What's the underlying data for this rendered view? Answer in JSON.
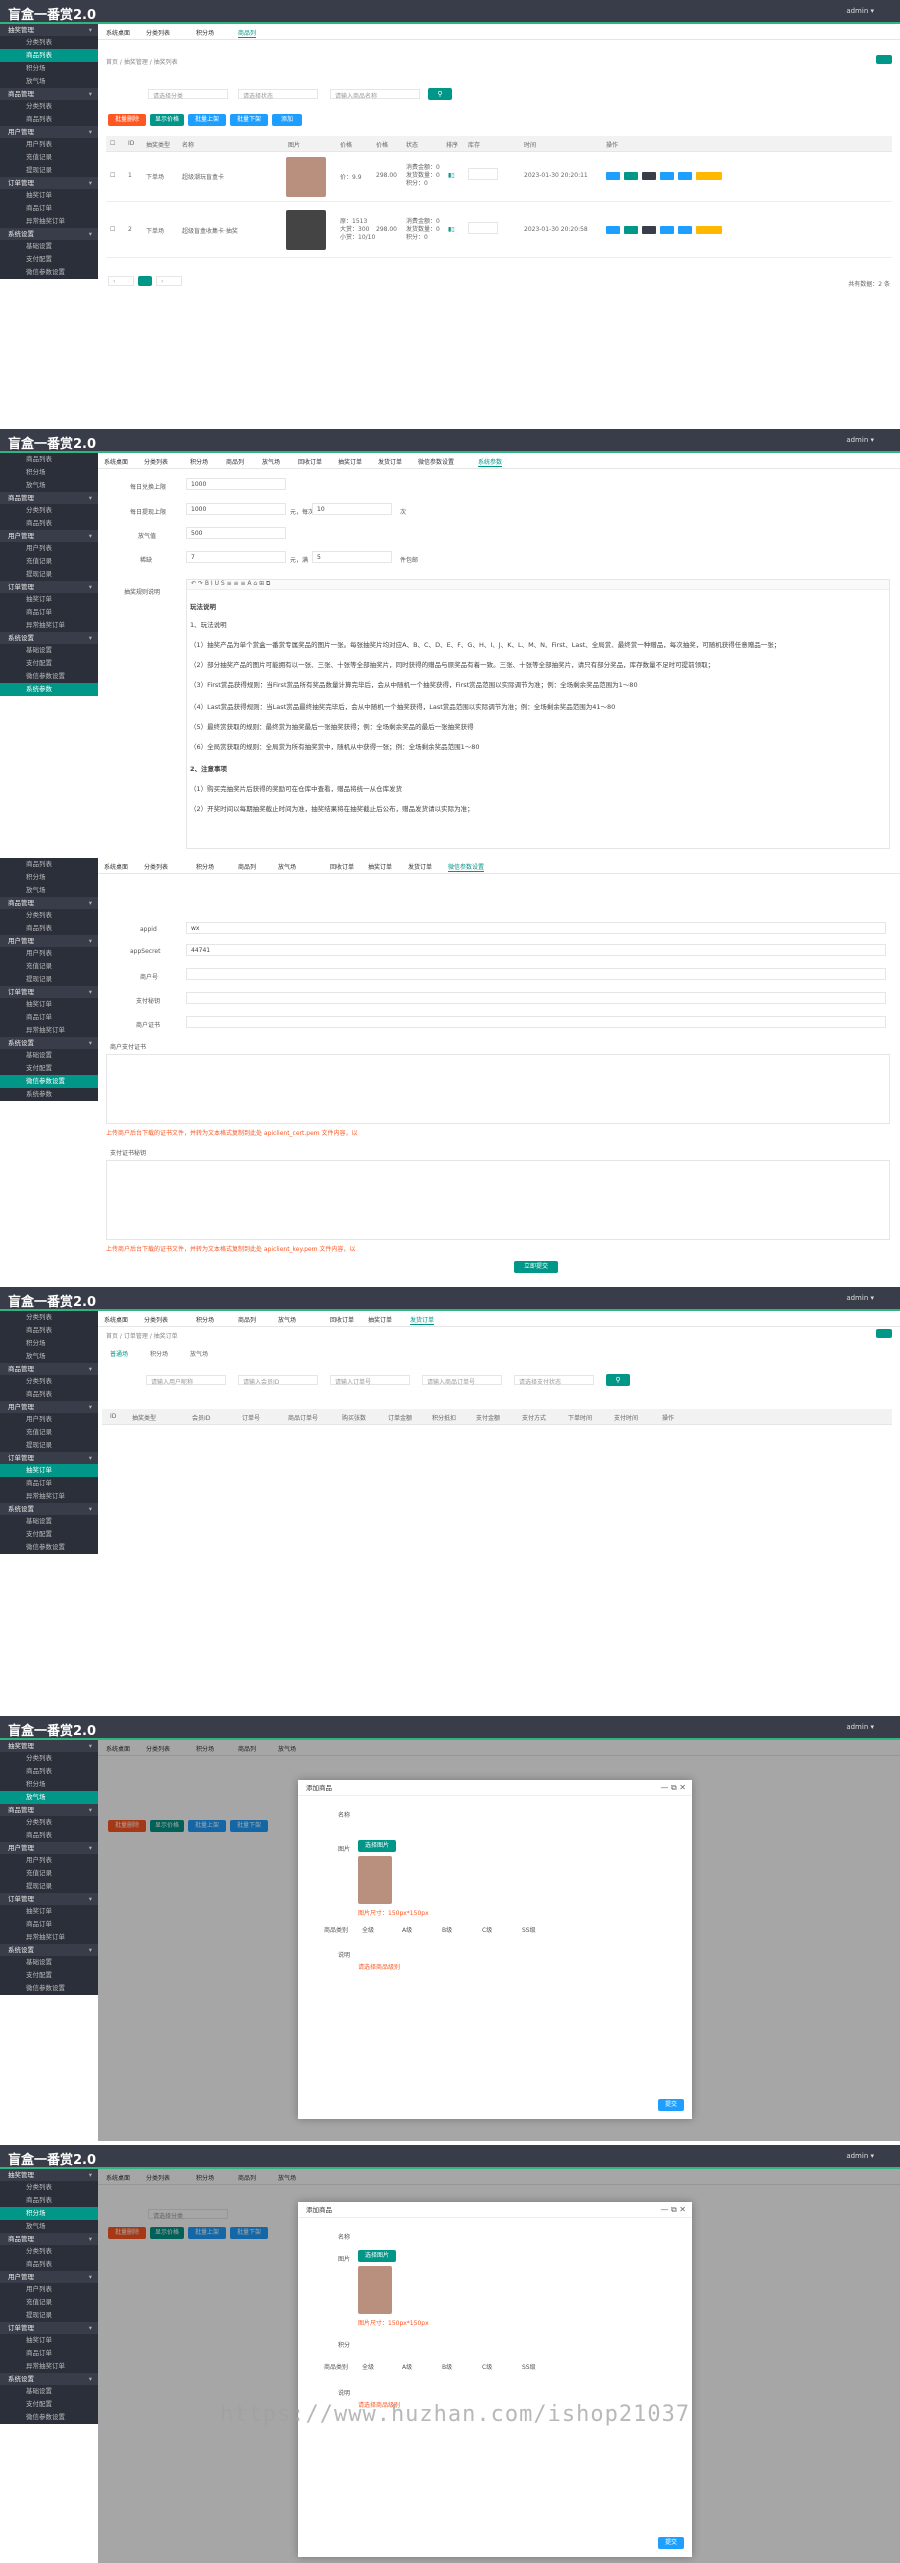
{
  "app_title": "盲盒一番赏2.0",
  "admin_label": "admin ▾",
  "sidebar": [
    {
      "label": "抽奖管理",
      "items": [
        "分类列表",
        "商品列表",
        "积分场",
        "放气场"
      ]
    },
    {
      "label": "商品管理",
      "items": [
        "分类列表",
        "商品列表"
      ]
    },
    {
      "label": "用户管理",
      "items": [
        "用户列表",
        "充值记录",
        "提现记录"
      ]
    },
    {
      "label": "订单管理",
      "items": [
        "抽奖订单",
        "商品订单",
        "异常抽奖订单"
      ]
    },
    {
      "label": "系统设置",
      "items": [
        "基础设置",
        "支付配置",
        "微信参数设置",
        "系统参数"
      ]
    }
  ],
  "panel1": {
    "tabs": [
      "系统桌面",
      "分类列表",
      "积分场",
      "商品列",
      "放气场"
    ],
    "breadcrumb": "首页 / 抽奖管理 / 抽奖列表",
    "filters": [
      "请选择分类",
      "请选择状态",
      "请输入商品名称"
    ],
    "buttons": [
      "批量删除",
      "显示价格",
      "批量上架",
      "批量下架",
      "添加"
    ],
    "columns": [
      "ID",
      "抽奖类型",
      "名称",
      "图片",
      "价格",
      "价格",
      "状态",
      "排序",
      "库存",
      "时间",
      "操作"
    ],
    "rows": [
      {
        "id": "1",
        "type": "下单场",
        "name": "超级潮玩盲盒卡",
        "price": "价：9.9",
        "p2": "298.00",
        "stats": "消费金额：0\n发货数量：0\n积分：0",
        "date": "2023-01-30 20:20:11"
      },
      {
        "id": "2",
        "type": "下单场",
        "name": "超级盲盒收集卡·抽奖",
        "price": "原：1513\n大赏：300\n小赏：10/10",
        "p2": "298.00",
        "stats": "消费金额：0\n发货数量：0\n积分：0",
        "date": "2023-01-30 20:20:58"
      }
    ],
    "row_actions": [
      "编辑",
      "删除",
      "下架",
      "查看",
      "商品",
      "commit"
    ],
    "pager_total": "共有数据：2 条"
  },
  "panel2": {
    "tabs": [
      "系统桌面",
      "分类列表",
      "积分场",
      "商品列",
      "放气场",
      "回收订单",
      "抽奖订单",
      "发货订单",
      "微信参数设置",
      "系统参数"
    ],
    "fields": [
      {
        "label": "每日兑换上限",
        "value": "1000"
      },
      {
        "label": "每日提现上限",
        "value": "1000",
        "mid": "元，每次",
        "v2": "10",
        "unit": "次"
      },
      {
        "label": "放气值",
        "value": "500"
      },
      {
        "label": "稀缺",
        "value": "7",
        "mid": "元，满",
        "v2": "5",
        "unit": "件包邮"
      }
    ],
    "editor_label": "抽奖规则说明",
    "paragraphs": [
      "玩法说明",
      "1、玩法说明",
      "（1）抽奖产品为单个赏盒一番赏专属奖品的图片一张。每张抽奖片均对应A、B、C、D、E、F、G、H、I、J、K、L、M、N、First、Last、全局赏、最终赏一种赠品，每次抽奖，可随机获得任意赠品一张；",
      "（2）部分抽奖产品的图片可能拥有以一张、三张、十张等全部抽奖片，同时获得的赠品与原奖品有着一致。三张、十张等全部抽奖片，请只有部分奖品，库存数量不足时可提前领取；",
      "（3）First赏品获得规则：当First赏品所有奖品数量计算完毕后，会从中随机一个抽奖获得，First赏品范围以实际调节为准；例：全场剩余奖品范围为1～80",
      "（4）Last赏品获得规则：当Last赏品最终抽奖完毕后，会从中随机一个抽奖获得，Last赏品范围以实际调节为准；例：全场剩余奖品范围为41～80",
      "（5）最终赏获取的规则：最终赏为抽奖最后一张抽奖获得；例：全场剩余奖品的最后一张抽奖获得",
      "（6）全局赏获取的规则：全局赏为所有抽奖赏中，随机从中获得一张；例：全场剩余奖品范围1～80",
      "2、注意事项",
      "（1）购买完抽奖片后获得的奖励可在仓库中查看，赠品将统一从仓库发货",
      "（2）开奖时间以每期抽奖截止时间为准，抽奖结果将在抽奖截止后公布，赠品发货请以实际为准；"
    ]
  },
  "panel3": {
    "tabs": [
      "系统桌面",
      "分类列表",
      "积分场",
      "商品列",
      "放气场",
      "回收订单",
      "抽奖订单",
      "发货订单",
      "微信参数设置"
    ],
    "fields": [
      {
        "label": "appid",
        "value": "wx"
      },
      {
        "label": "appSecret",
        "value": "44741"
      },
      {
        "label": "商户号",
        "value": ""
      },
      {
        "label": "支付秘钥",
        "value": ""
      },
      {
        "label": "商户证书",
        "value": "（请填写）"
      }
    ],
    "cert_label": "商户支付证书",
    "cert_hint": "上传商户后台下载的证书文件，并转为文本格式复制到此处 apiclient_cert.pem 文件内容，以",
    "key_label": "支付证书秘钥",
    "key_hint": "上传商户后台下载的证书文件，并转为文本格式复制到此处 apiclient_key.pem 文件内容，以",
    "submit": "立即提交"
  },
  "panel4": {
    "tabs": [
      "系统桌面",
      "分类列表",
      "积分场",
      "商品列",
      "放气场",
      "回收订单",
      "抽奖订单",
      "发货订单"
    ],
    "breadcrumb": "首页 / 订单管理 / 抽奖订单",
    "subtabs": [
      "普通场",
      "积分场",
      "放气场"
    ],
    "filters": [
      "请输入用户昵称",
      "请输入会员ID",
      "请输入订单号",
      "请输入商品订单号",
      "请选择支付状态"
    ],
    "columns": [
      "ID",
      "抽奖类型",
      "会员ID",
      "订单号",
      "商品订单号",
      "购买张数",
      "订单金额",
      "积分抵扣",
      "支付金额",
      "支付方式",
      "下单时间",
      "支付时间",
      "操作"
    ]
  },
  "panel5": {
    "modal_title": "添加商品",
    "name_label": "名称",
    "img_label": "图片",
    "img_button": "选择图片",
    "img_hint": "图片尺寸：150px*150px",
    "rank_label": "商品类别",
    "ranks": [
      "全级",
      "A级",
      "B级",
      "C级",
      "SS级"
    ],
    "desc_label": "说明",
    "desc_hint": "请选择商品级别",
    "submit": "提交"
  },
  "panel6": {
    "modal_title": "添加商品",
    "name_label": "名称",
    "img_label": "图片",
    "img_button": "选择图片",
    "img_hint": "图片尺寸：150px*150px",
    "points_label": "积分",
    "rank_label": "商品类别",
    "ranks": [
      "全级",
      "A级",
      "B级",
      "C级",
      "SS级"
    ],
    "desc_label": "说明",
    "desc_hint": "请选择商品级别",
    "submit": "提交"
  },
  "watermark": "https://www.huzhan.com/ishop21037"
}
